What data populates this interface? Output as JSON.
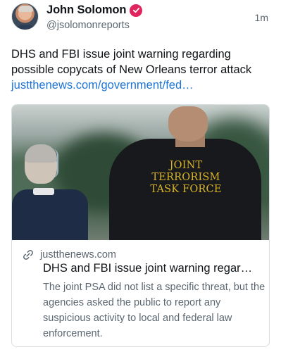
{
  "author": {
    "display_name": "John Solomon",
    "handle": "@jsolomonreports",
    "timestamp": "1m",
    "verified_color": "#e0245e"
  },
  "post": {
    "text": "DHS and FBI issue joint warning regarding possible copycats of New Orleans terror attack ",
    "link_text": "justthenews.com/government/fed…",
    "link_color": "#1d74d6"
  },
  "link_card": {
    "image_jacket_text": "JOINT\nTERRORISM\nTASK FORCE",
    "domain": "justthenews.com",
    "title": "DHS and FBI issue joint warning regar…",
    "description": "The joint PSA did not list a specific threat, but the agencies asked the public to report any suspicious activity to local and federal law enforcement."
  },
  "icons": {
    "verified": "verified-badge-icon",
    "link": "link-icon"
  }
}
